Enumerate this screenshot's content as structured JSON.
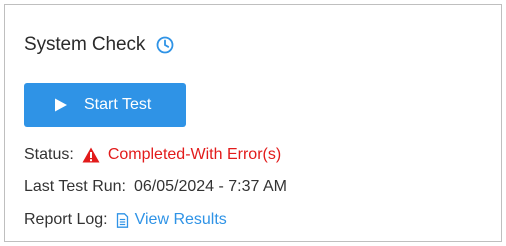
{
  "panel": {
    "title": "System Check",
    "history_icon": "clock-icon"
  },
  "actions": {
    "start_test_label": "Start Test",
    "start_test_icon": "play-icon"
  },
  "status": {
    "label": "Status:",
    "value": "Completed-With Error(s)",
    "icon": "warning-icon"
  },
  "last_run": {
    "label": "Last Test Run:",
    "value": "06/05/2024 - 7:37 AM"
  },
  "report": {
    "label": "Report Log:",
    "link_text": "View Results",
    "icon": "document-icon"
  },
  "colors": {
    "accent": "#2f93e6",
    "error": "#e21b1b",
    "link": "#2f93e6",
    "text": "#333333",
    "border": "#bfbfbf"
  }
}
